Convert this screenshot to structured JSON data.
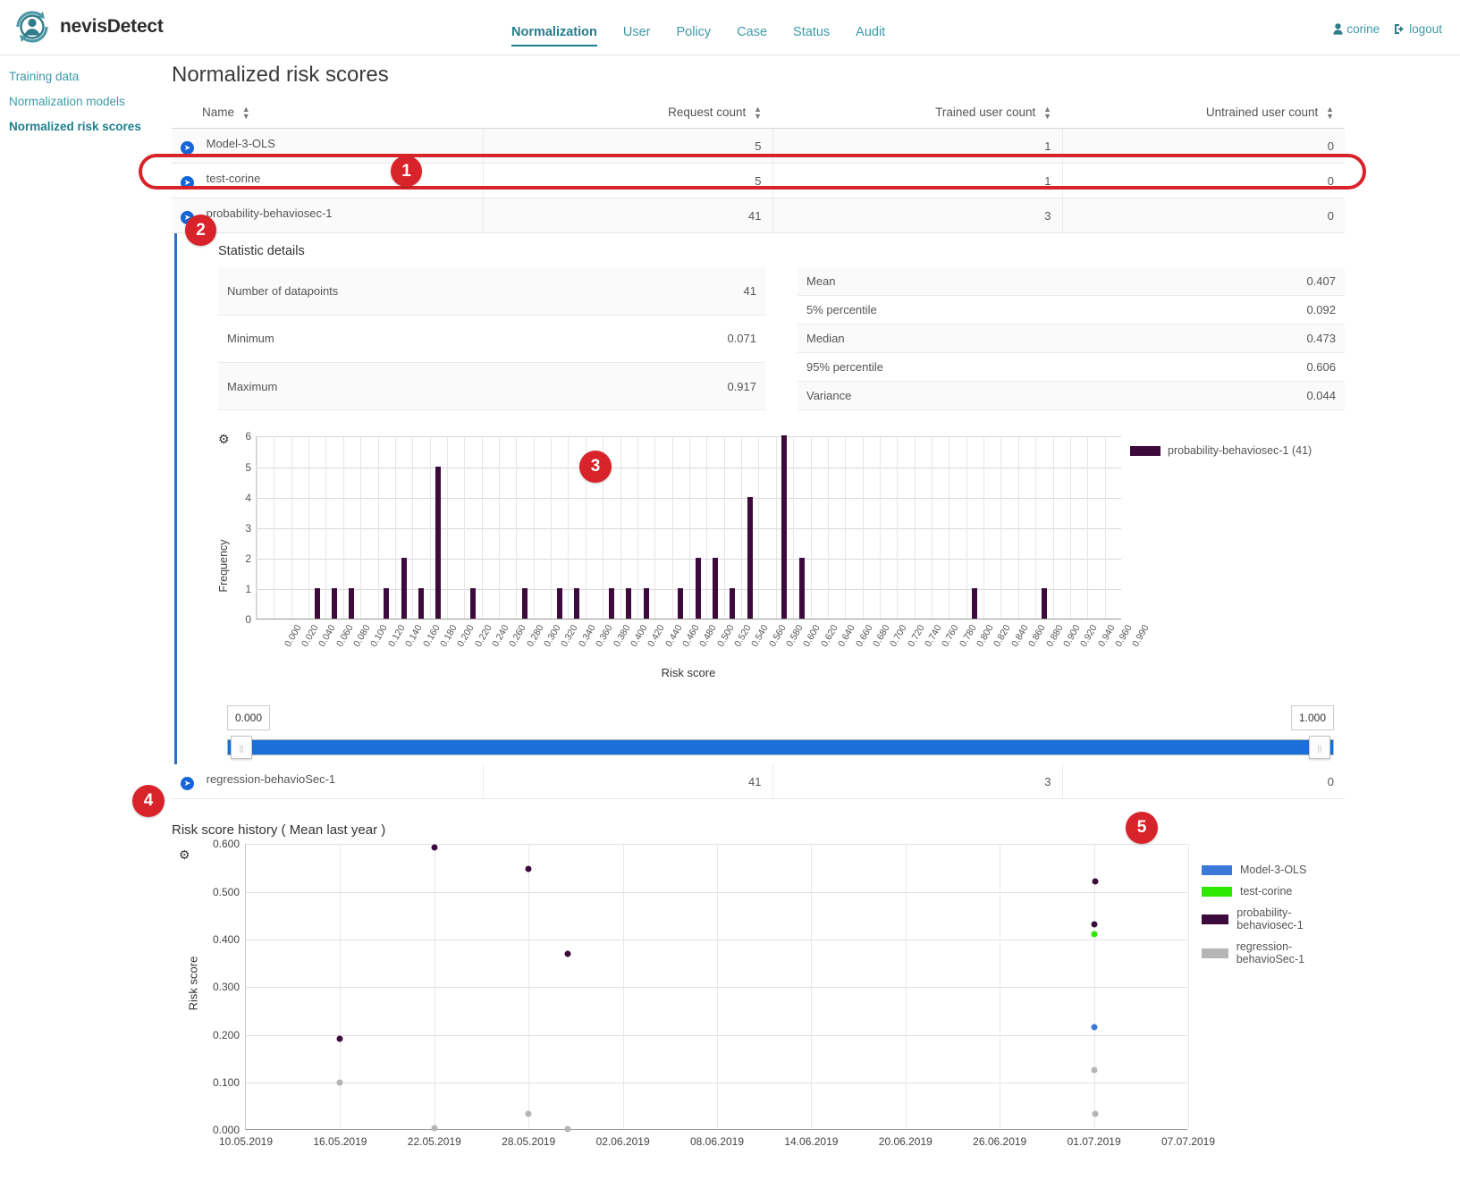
{
  "app": {
    "brand": "nevisDetect",
    "logo_icon": "user-circle-refresh-icon"
  },
  "header": {
    "nav": [
      {
        "label": "Normalization",
        "active": true
      },
      {
        "label": "User",
        "active": false
      },
      {
        "label": "Policy",
        "active": false
      },
      {
        "label": "Case",
        "active": false
      },
      {
        "label": "Status",
        "active": false
      },
      {
        "label": "Audit",
        "active": false
      }
    ],
    "user": {
      "name": "corine",
      "icon": "user-icon"
    },
    "logout": {
      "label": "logout",
      "icon": "logout-icon"
    },
    "accent_color": "#1f7f8c"
  },
  "sidebar": {
    "items": [
      {
        "label": "Training data",
        "active": false
      },
      {
        "label": "Normalization models",
        "active": false
      },
      {
        "label": "Normalized risk scores",
        "active": true
      }
    ]
  },
  "main": {
    "page_title": "Normalized risk scores",
    "table": {
      "columns": [
        "Name",
        "Request count",
        "Trained user count",
        "Untrained user count"
      ],
      "rows": [
        {
          "name": "Model-3-OLS",
          "request_count": "5",
          "trained_user_count": "1",
          "untrained_user_count": "0",
          "expanded": false
        },
        {
          "name": "test-corine",
          "request_count": "5",
          "trained_user_count": "1",
          "untrained_user_count": "0",
          "expanded": false
        },
        {
          "name": "probability-behaviosec-1",
          "request_count": "41",
          "trained_user_count": "3",
          "untrained_user_count": "0",
          "expanded": true
        },
        {
          "name": "regression-behavioSec-1",
          "request_count": "41",
          "trained_user_count": "3",
          "untrained_user_count": "0",
          "expanded": false
        }
      ]
    },
    "detail": {
      "title": "Statistic details",
      "left_stats": [
        {
          "label": "Number of datapoints",
          "value": "41"
        },
        {
          "label": "Minimum",
          "value": "0.071"
        },
        {
          "label": "Maximum",
          "value": "0.917"
        }
      ],
      "right_stats": [
        {
          "label": "Mean",
          "value": "0.407"
        },
        {
          "label": "5% percentile",
          "value": "0.092"
        },
        {
          "label": "Median",
          "value": "0.473"
        },
        {
          "label": "95% percentile",
          "value": "0.606"
        },
        {
          "label": "Variance",
          "value": "0.044"
        }
      ]
    },
    "slider": {
      "min_value": "0.000",
      "max_value": "1.000",
      "track_color": "#1d6fd8"
    }
  },
  "chart_data": [
    {
      "type": "bar",
      "name": "risk-score-histogram",
      "title": "",
      "xlabel": "Risk score",
      "ylabel": "Frequency",
      "ylim": [
        0,
        6
      ],
      "yticks": [
        0,
        1,
        2,
        3,
        4,
        5,
        6
      ],
      "grid": true,
      "legend_position": "right",
      "legend": [
        {
          "name": "probability-behaviosec-1 (41)",
          "color": "#3d0a3d"
        }
      ],
      "gear_icon": "gear-icon",
      "categories": [
        "0.000",
        "0.020",
        "0.040",
        "0.060",
        "0.080",
        "0.100",
        "0.120",
        "0.140",
        "0.160",
        "0.180",
        "0.200",
        "0.220",
        "0.240",
        "0.260",
        "0.280",
        "0.300",
        "0.320",
        "0.340",
        "0.360",
        "0.380",
        "0.400",
        "0.420",
        "0.440",
        "0.460",
        "0.480",
        "0.500",
        "0.520",
        "0.540",
        "0.560",
        "0.580",
        "0.600",
        "0.620",
        "0.640",
        "0.660",
        "0.680",
        "0.700",
        "0.720",
        "0.740",
        "0.760",
        "0.780",
        "0.800",
        "0.820",
        "0.840",
        "0.860",
        "0.880",
        "0.900",
        "0.920",
        "0.940",
        "0.960",
        "0.990"
      ],
      "values": [
        0,
        0,
        0,
        1,
        1,
        1,
        0,
        1,
        2,
        1,
        5,
        0,
        1,
        0,
        0,
        1,
        0,
        1,
        1,
        0,
        1,
        1,
        1,
        0,
        1,
        2,
        2,
        1,
        4,
        0,
        6,
        2,
        0,
        0,
        0,
        0,
        0,
        0,
        0,
        0,
        0,
        1,
        0,
        0,
        0,
        1,
        0,
        0,
        0,
        0
      ]
    },
    {
      "type": "scatter",
      "name": "risk-score-history",
      "title": "Risk score history ( Mean last year )",
      "xlabel": "",
      "ylabel": "Risk score",
      "ylim": [
        0.0,
        0.6
      ],
      "yticks": [
        "0.000",
        "0.100",
        "0.200",
        "0.300",
        "0.400",
        "0.500",
        "0.600"
      ],
      "xticks": [
        "10.05.2019",
        "16.05.2019",
        "22.05.2019",
        "28.05.2019",
        "02.06.2019",
        "08.06.2019",
        "14.06.2019",
        "20.06.2019",
        "26.06.2019",
        "01.07.2019",
        "07.07.2019"
      ],
      "grid": true,
      "legend_position": "right",
      "gear_icon": "gear-icon",
      "series": [
        {
          "name": "Model-3-OLS",
          "color": "#3b78d8",
          "points": [
            {
              "x": "01.07.2019",
              "y": 0.215
            }
          ]
        },
        {
          "name": "test-corine",
          "color": "#2ee800",
          "points": [
            {
              "x": "01.07.2019",
              "y": 0.409
            }
          ]
        },
        {
          "name": "probability-behaviosec-1",
          "color": "#3d0a3d",
          "points": [
            {
              "x": "16.05.2019",
              "y": 0.191
            },
            {
              "x": "22.05.2019",
              "y": 0.592
            },
            {
              "x": "28.05.2019",
              "y": 0.546
            },
            {
              "x": "30.05.2019",
              "y": 0.369
            },
            {
              "x": "01.07.2019",
              "y": 0.43
            },
            {
              "x": "01.07.2019",
              "y": 0.521
            }
          ]
        },
        {
          "name": "regression-behavioSec-1",
          "color": "#b5b5b5",
          "points": [
            {
              "x": "16.05.2019",
              "y": 0.098
            },
            {
              "x": "22.05.2019",
              "y": 0.002
            },
            {
              "x": "28.05.2019",
              "y": 0.033
            },
            {
              "x": "30.05.2019",
              "y": 0.0
            },
            {
              "x": "01.07.2019",
              "y": 0.125
            },
            {
              "x": "01.07.2019",
              "y": 0.033
            }
          ]
        }
      ]
    }
  ],
  "callouts": [
    {
      "label": "1"
    },
    {
      "label": "2"
    },
    {
      "label": "3"
    },
    {
      "label": "4"
    },
    {
      "label": "5"
    }
  ]
}
